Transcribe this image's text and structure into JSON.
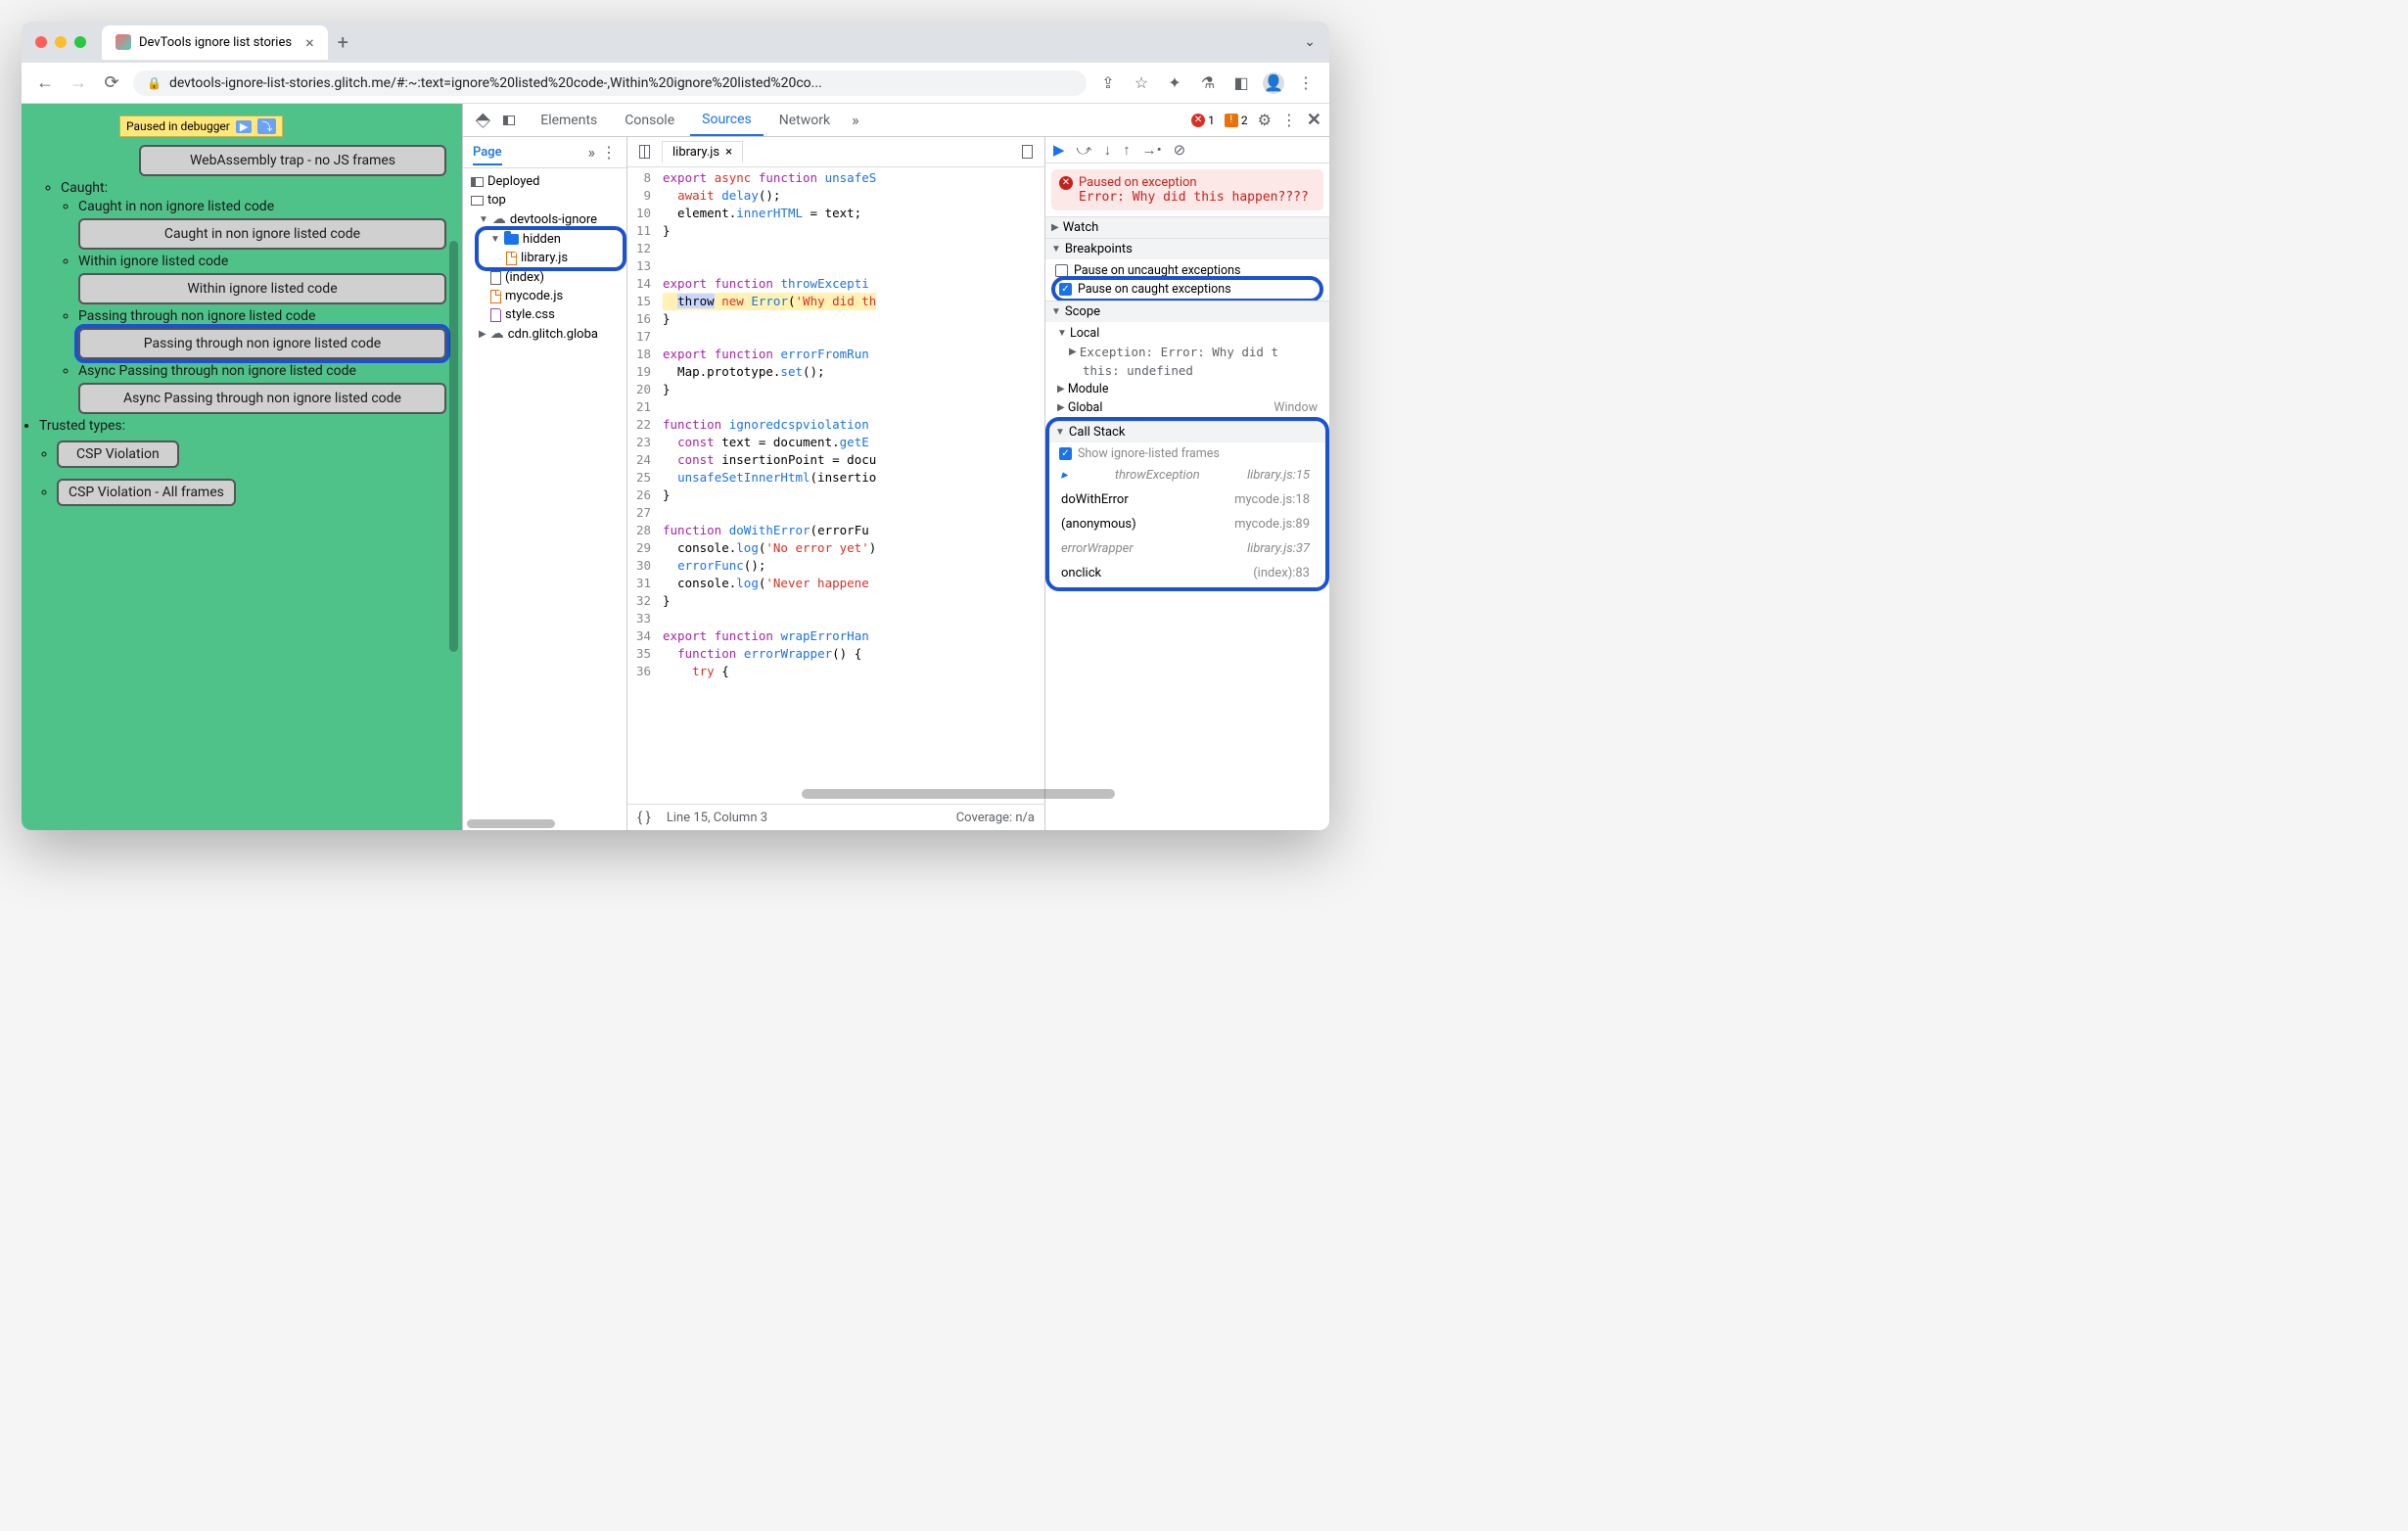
{
  "browser": {
    "tab_title": "DevTools ignore list stories",
    "url": "devtools-ignore-list-stories.glitch.me/#:~:text=ignore%20listed%20code-,Within%20ignore%20listed%20co..."
  },
  "page": {
    "paused_label": "Paused in debugger",
    "card_top": "WebAssembly trap - no JS frames",
    "caught_header": "Caught:",
    "caught_non_ignore": "Caught in non ignore listed code",
    "btn_caught_non_ignore": "Caught in non ignore listed code",
    "within_ignore": "Within ignore listed code",
    "btn_within_ignore": "Within ignore listed code",
    "passing_through": "Passing through non ignore listed code",
    "btn_passing_through": "Passing through non ignore listed code",
    "async_passing": "Async Passing through non ignore listed code",
    "btn_async_passing": "Async Passing through non ignore listed code",
    "trusted_types": "Trusted types:",
    "csp_violation": "CSP Violation",
    "csp_violation_all": "CSP Violation - All frames"
  },
  "devtools": {
    "tabs": {
      "elements": "Elements",
      "console": "Console",
      "sources": "Sources",
      "network": "Network"
    },
    "err_count": "1",
    "warn_count": "2",
    "page_tab": "Page",
    "tree": {
      "deployed": "Deployed",
      "top": "top",
      "domain": "devtools-ignore",
      "hidden": "hidden",
      "library": "library.js",
      "index": "(index)",
      "mycode": "mycode.js",
      "style": "style.css",
      "cdn": "cdn.glitch.globa"
    },
    "editor_tab": "library.js",
    "code_lines": [
      {
        "n": 8,
        "h": "<span class='kw'>export</span> <span class='kw2'>async</span> <span class='kw'>function</span> <span class='fn'>unsafeS</span>"
      },
      {
        "n": 9,
        "h": "  <span class='kw2'>await</span> <span class='fn'>delay</span>();"
      },
      {
        "n": 10,
        "h": "  element.<span class='fn'>innerHTML</span> = text;"
      },
      {
        "n": 11,
        "h": "}"
      },
      {
        "n": 12,
        "h": ""
      },
      {
        "n": 13,
        "h": ""
      },
      {
        "n": 14,
        "h": "<span class='kw'>export</span> <span class='kw'>function</span> <span class='fn'>throwExcepti</span>"
      },
      {
        "n": 15,
        "h": "  <span class='hi-throw'>throw</span> <span class='kw2'>new</span> <span class='fn'>Error</span>(<span class='str'>'Why did th</span>",
        "hi": true
      },
      {
        "n": 16,
        "h": "}"
      },
      {
        "n": 17,
        "h": ""
      },
      {
        "n": 18,
        "h": "<span class='kw'>export</span> <span class='kw'>function</span> <span class='fn'>errorFromRun</span>"
      },
      {
        "n": 19,
        "h": "  Map.prototype.<span class='fn'>set</span>();"
      },
      {
        "n": 20,
        "h": "}"
      },
      {
        "n": 21,
        "h": ""
      },
      {
        "n": 22,
        "h": "<span class='kw'>function</span> <span class='fn'>ignoredcspviolation</span>"
      },
      {
        "n": 23,
        "h": "  <span class='kw'>const</span> text = document.<span class='fn'>getE</span>"
      },
      {
        "n": 24,
        "h": "  <span class='kw'>const</span> insertionPoint = docu"
      },
      {
        "n": 25,
        "h": "  <span class='fn'>unsafeSetInnerHtml</span>(insertio"
      },
      {
        "n": 26,
        "h": "}"
      },
      {
        "n": 27,
        "h": ""
      },
      {
        "n": 28,
        "h": "<span class='kw'>function</span> <span class='fn'>doWithError</span>(errorFu"
      },
      {
        "n": 29,
        "h": "  console.<span class='fn'>log</span>(<span class='str'>'No error yet'</span>)"
      },
      {
        "n": 30,
        "h": "  <span class='fn'>errorFunc</span>();"
      },
      {
        "n": 31,
        "h": "  console.<span class='fn'>log</span>(<span class='str'>'Never happene</span>"
      },
      {
        "n": 32,
        "h": "}"
      },
      {
        "n": 33,
        "h": ""
      },
      {
        "n": 34,
        "h": "<span class='kw'>export</span> <span class='kw'>function</span> <span class='fn'>wrapErrorHan</span>"
      },
      {
        "n": 35,
        "h": "  <span class='kw'>function</span> <span class='fn'>errorWrapper</span>() {"
      },
      {
        "n": 36,
        "h": "    <span class='kw2'>try</span> {"
      }
    ],
    "status_line": "Line 15, Column 3",
    "status_coverage": "Coverage: n/a",
    "paused_header": "Paused on exception",
    "paused_msg": "Error: Why did this happen????",
    "panels": {
      "watch": "Watch",
      "breakpoints": "Breakpoints",
      "bp_uncaught": "Pause on uncaught exceptions",
      "bp_caught": "Pause on caught exceptions",
      "scope": "Scope",
      "local": "Local",
      "exc_label": "Exception",
      "exc_val": ": Error: Why did t",
      "this_label": "this",
      "this_val": ": undefined",
      "module": "Module",
      "global": "Global",
      "window": "Window",
      "callstack": "Call Stack",
      "show_ignore": "Show ignore-listed frames"
    },
    "stack": [
      {
        "fn": "throwException",
        "src": "library.js:15",
        "dim": true,
        "current": true
      },
      {
        "fn": "doWithError",
        "src": "mycode.js:18"
      },
      {
        "fn": "(anonymous)",
        "src": "mycode.js:89"
      },
      {
        "fn": "errorWrapper",
        "src": "library.js:37",
        "dim": true
      },
      {
        "fn": "onclick",
        "src": "(index):83"
      }
    ]
  }
}
